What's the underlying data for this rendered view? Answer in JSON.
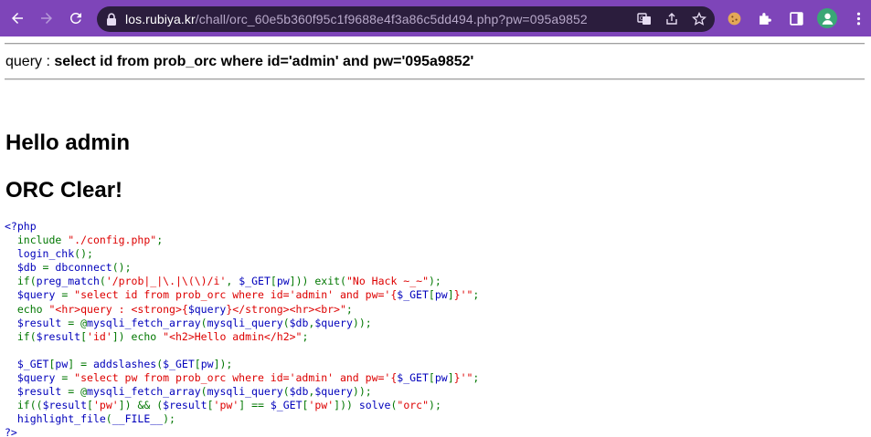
{
  "browser": {
    "url_host": "los.rubiya.kr",
    "url_path": "/chall/orc_60e5b360f95c1f9688e4f3a86c5dd494.php?pw=095a9852"
  },
  "page": {
    "query_prefix": "query : ",
    "query_sql": "select id from prob_orc where id='admin' and pw='095a9852'",
    "hello": "Hello admin",
    "clear": "ORC Clear!"
  },
  "source_code": [
    [
      [
        "k",
        "<?php"
      ]
    ],
    [
      [
        "k",
        "  "
      ],
      [
        "o",
        "include "
      ],
      [
        "s",
        "\"./config.php\""
      ],
      [
        "o",
        ";"
      ]
    ],
    [
      [
        "k",
        "  login_chk"
      ],
      [
        "o",
        "();"
      ]
    ],
    [
      [
        "k",
        "  $db "
      ],
      [
        "o",
        "= "
      ],
      [
        "k",
        "dbconnect"
      ],
      [
        "o",
        "();"
      ]
    ],
    [
      [
        "k",
        "  "
      ],
      [
        "o",
        "if("
      ],
      [
        "k",
        "preg_match"
      ],
      [
        "o",
        "("
      ],
      [
        "s",
        "'/prob|_|\\.|\\(\\)/i'"
      ],
      [
        "o",
        ", "
      ],
      [
        "k",
        "$_GET"
      ],
      [
        "o",
        "["
      ],
      [
        "k",
        "pw"
      ],
      [
        "o",
        "])) exit("
      ],
      [
        "s",
        "\"No Hack ~_~\""
      ],
      [
        "o",
        ");"
      ]
    ],
    [
      [
        "k",
        "  $query "
      ],
      [
        "o",
        "= "
      ],
      [
        "s",
        "\"select id from prob_orc where id='admin' and pw='{"
      ],
      [
        "k",
        "$_GET"
      ],
      [
        "o",
        "["
      ],
      [
        "k",
        "pw"
      ],
      [
        "o",
        "]"
      ],
      [
        "s",
        "}'\""
      ],
      [
        "o",
        ";"
      ]
    ],
    [
      [
        "k",
        "  "
      ],
      [
        "o",
        "echo "
      ],
      [
        "s",
        "\"<hr>query : <strong>{"
      ],
      [
        "k",
        "$query"
      ],
      [
        "s",
        "}</strong><hr><br>\""
      ],
      [
        "o",
        ";"
      ]
    ],
    [
      [
        "k",
        "  $result "
      ],
      [
        "o",
        "= @"
      ],
      [
        "k",
        "mysqli_fetch_array"
      ],
      [
        "o",
        "("
      ],
      [
        "k",
        "mysqli_query"
      ],
      [
        "o",
        "("
      ],
      [
        "k",
        "$db"
      ],
      [
        "o",
        ","
      ],
      [
        "k",
        "$query"
      ],
      [
        "o",
        "));"
      ]
    ],
    [
      [
        "k",
        "  "
      ],
      [
        "o",
        "if("
      ],
      [
        "k",
        "$result"
      ],
      [
        "o",
        "["
      ],
      [
        "s",
        "'id'"
      ],
      [
        "o",
        "]) echo "
      ],
      [
        "s",
        "\"<h2>Hello admin</h2>\""
      ],
      [
        "o",
        ";"
      ]
    ],
    [
      [
        "k",
        ""
      ]
    ],
    [
      [
        "k",
        "  $_GET"
      ],
      [
        "o",
        "["
      ],
      [
        "k",
        "pw"
      ],
      [
        "o",
        "] = "
      ],
      [
        "k",
        "addslashes"
      ],
      [
        "o",
        "("
      ],
      [
        "k",
        "$_GET"
      ],
      [
        "o",
        "["
      ],
      [
        "k",
        "pw"
      ],
      [
        "o",
        "]);"
      ]
    ],
    [
      [
        "k",
        "  $query "
      ],
      [
        "o",
        "= "
      ],
      [
        "s",
        "\"select pw from prob_orc where id='admin' and pw='{"
      ],
      [
        "k",
        "$_GET"
      ],
      [
        "o",
        "["
      ],
      [
        "k",
        "pw"
      ],
      [
        "o",
        "]"
      ],
      [
        "s",
        "}'\""
      ],
      [
        "o",
        ";"
      ]
    ],
    [
      [
        "k",
        "  $result "
      ],
      [
        "o",
        "= @"
      ],
      [
        "k",
        "mysqli_fetch_array"
      ],
      [
        "o",
        "("
      ],
      [
        "k",
        "mysqli_query"
      ],
      [
        "o",
        "("
      ],
      [
        "k",
        "$db"
      ],
      [
        "o",
        ","
      ],
      [
        "k",
        "$query"
      ],
      [
        "o",
        "));"
      ]
    ],
    [
      [
        "k",
        "  "
      ],
      [
        "o",
        "if(("
      ],
      [
        "k",
        "$result"
      ],
      [
        "o",
        "["
      ],
      [
        "s",
        "'pw'"
      ],
      [
        "o",
        "]) && ("
      ],
      [
        "k",
        "$result"
      ],
      [
        "o",
        "["
      ],
      [
        "s",
        "'pw'"
      ],
      [
        "o",
        "] == "
      ],
      [
        "k",
        "$_GET"
      ],
      [
        "o",
        "["
      ],
      [
        "s",
        "'pw'"
      ],
      [
        "o",
        "])) "
      ],
      [
        "k",
        "solve"
      ],
      [
        "o",
        "("
      ],
      [
        "s",
        "\"orc\""
      ],
      [
        "o",
        ");"
      ]
    ],
    [
      [
        "k",
        "  highlight_file"
      ],
      [
        "o",
        "("
      ],
      [
        "k",
        "__FILE__"
      ],
      [
        "o",
        ");"
      ]
    ],
    [
      [
        "k",
        "?>"
      ]
    ]
  ]
}
